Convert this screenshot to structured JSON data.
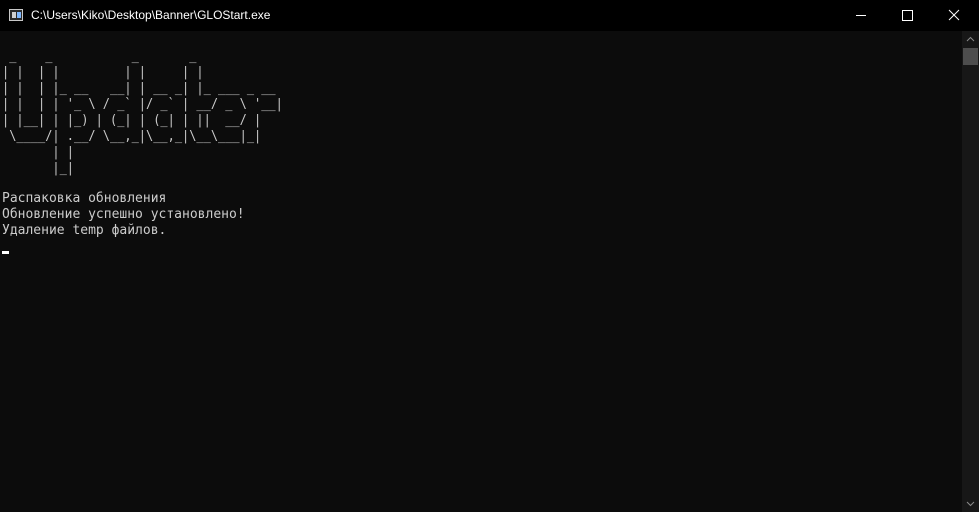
{
  "window": {
    "title": "C:\\Users\\Kiko\\Desktop\\Banner\\GLOStart.exe"
  },
  "console": {
    "banner": " _    _           _       _\n| |  | |         | |     | |\n| |  | |_ __   __| | __ _| |_ ___ _ __\n| |  | | '_ \\ / _` |/ _` | __/ _ \\ '__|\n| |__| | |_) | (_| | (_| | ||  __/ |\n \\____/| .__/ \\__,_|\\__,_|\\__\\___|_|\n       | |\n       |_|",
    "lines": [
      "Распаковка обновления",
      "Обновление успешно установлено!",
      "Удаление temp файлов."
    ]
  },
  "colors": {
    "background": "#0c0c0c",
    "text": "#cccccc",
    "titlebar": "#000000"
  }
}
